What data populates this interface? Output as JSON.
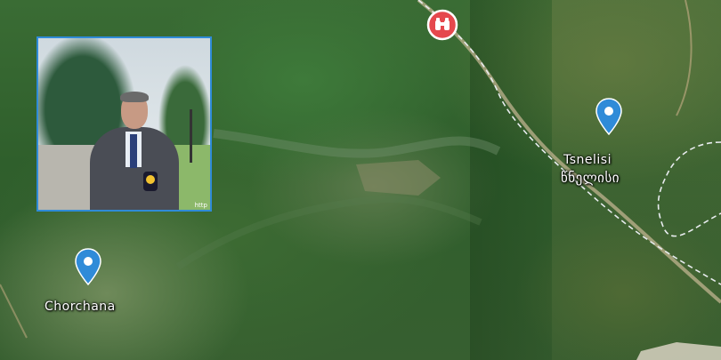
{
  "map": {
    "inset_watermark": "http",
    "places": [
      {
        "name": "Chorchana",
        "local_name": ""
      },
      {
        "name": "Tsnelisi",
        "local_name": "წნელისი"
      }
    ],
    "markers": [
      {
        "type": "place-pin",
        "icon": "location-pin-icon",
        "color": "#2f8bd8"
      },
      {
        "type": "place-pin",
        "icon": "location-pin-icon",
        "color": "#2f8bd8"
      },
      {
        "type": "viewpoint",
        "icon": "binoculars-icon",
        "color": "#e5484d"
      }
    ]
  }
}
